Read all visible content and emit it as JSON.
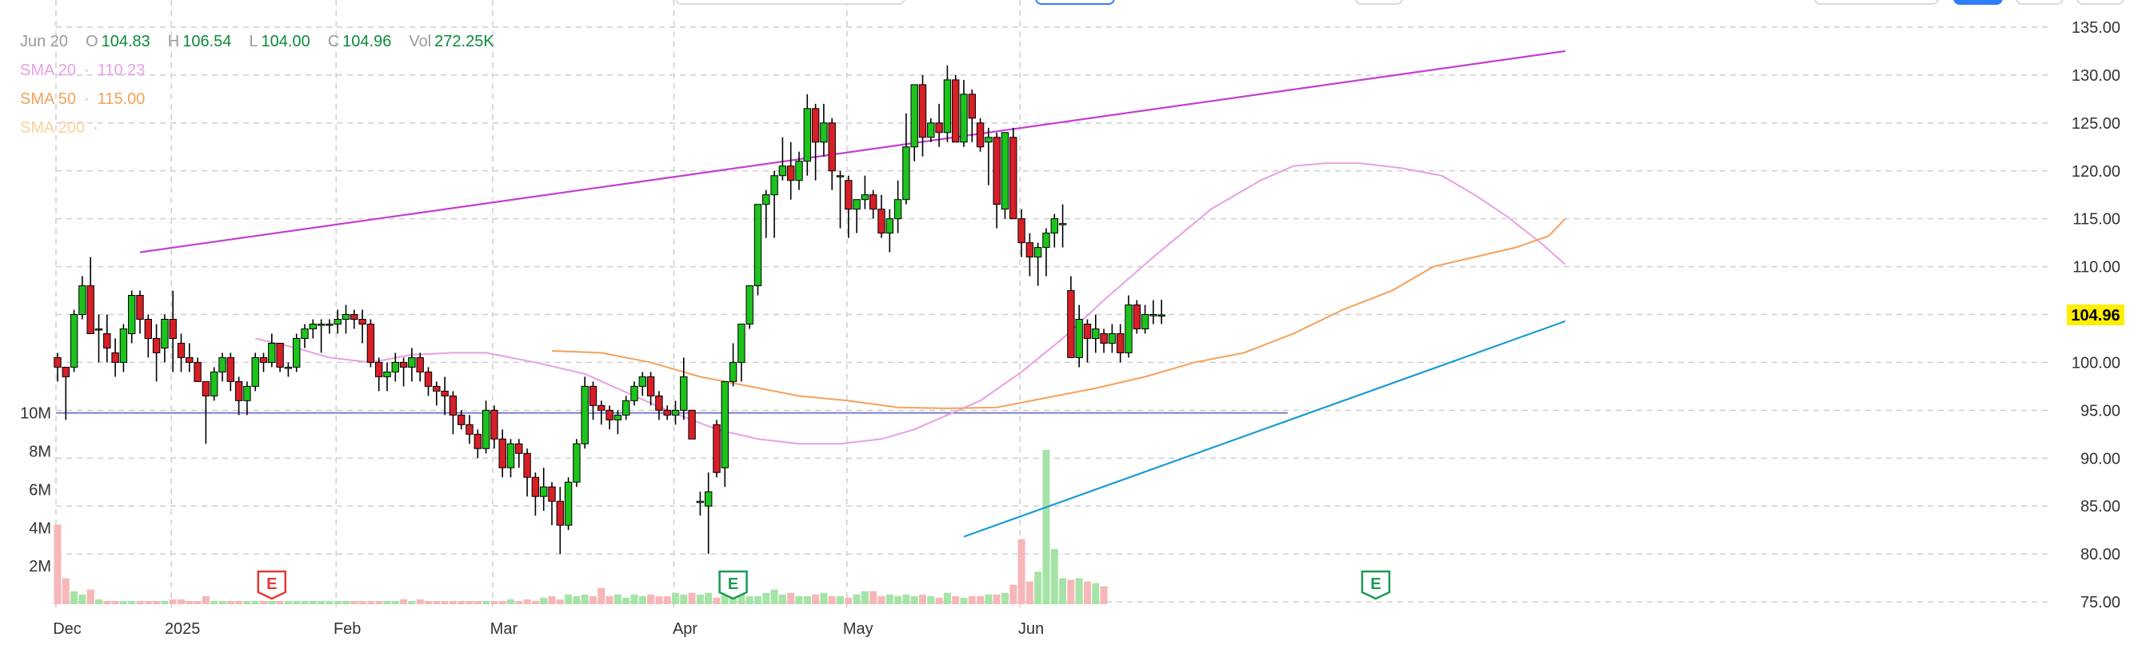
{
  "legend": {
    "date": "Jun 20",
    "open_label": "O",
    "open": "104.83",
    "high_label": "H",
    "high": "106.54",
    "low_label": "L",
    "low": "104.00",
    "close_label": "C",
    "close": "104.96",
    "vol_label": "Vol",
    "vol": "272.25K",
    "sma": [
      {
        "label": "SMA 20",
        "sep": "·",
        "value": "110.23",
        "color": "#e7a0e2"
      },
      {
        "label": "SMA 50",
        "sep": "·",
        "value": "115.00",
        "color": "#f5a15a"
      },
      {
        "label": "SMA 200",
        "sep": "·",
        "value": "",
        "color": "#f6d39a"
      }
    ]
  },
  "current_price": "104.96",
  "colors": {
    "up": "#1cc41c",
    "down": "#d61f26",
    "wick": "#000000",
    "grid": "#cfcfd4",
    "trendline_upper": "#c23fd1",
    "trendline_lower": "#1a9ad6",
    "sma20": "#e7a0e2",
    "sma50": "#f5a15a",
    "vol_up": "#a6e3a6",
    "vol_down": "#f6b7b9",
    "vol_ref": "#7c7ccf",
    "price_tag": "#ffee00",
    "earn_red": "#e53935",
    "earn_green": "#1a9a54"
  },
  "chart_data": {
    "type": "candlestick",
    "y_axis": {
      "ticks": [
        "135.00",
        "130.00",
        "125.00",
        "120.00",
        "115.00",
        "110.00",
        "105.00",
        "100.00",
        "95.00",
        "90.00",
        "85.00",
        "80.00",
        "75.00"
      ],
      "ylim": [
        75,
        135
      ]
    },
    "x_axis": {
      "labels": [
        "Dec",
        "2025",
        "Feb",
        "Mar",
        "Apr",
        "May",
        "Jun"
      ],
      "label_positions_index": [
        0,
        14,
        34,
        53,
        75,
        96,
        117
      ]
    },
    "volume_axis": {
      "labels": [
        "10M",
        "8M",
        "6M",
        "4M",
        "2M"
      ],
      "values": [
        10000000,
        8000000,
        6000000,
        4000000,
        2000000
      ],
      "reference_line": 10000000
    },
    "candles": [
      [
        100.5,
        101,
        98,
        99.5
      ],
      [
        99.5,
        99.5,
        94,
        98.5
      ],
      [
        99.5,
        105.5,
        99,
        105
      ],
      [
        105,
        109,
        104.5,
        108
      ],
      [
        108,
        111,
        104,
        103
      ],
      [
        103.5,
        105,
        100,
        103.5
      ],
      [
        103,
        105,
        100,
        101.5
      ],
      [
        101,
        102.5,
        98.5,
        100
      ],
      [
        100,
        104,
        99,
        103.5
      ],
      [
        103,
        107.5,
        102,
        107
      ],
      [
        107,
        107.5,
        103,
        104.5
      ],
      [
        104.5,
        105,
        100.5,
        102.5
      ],
      [
        102.5,
        104,
        98,
        101
      ],
      [
        101.5,
        105,
        100,
        104.5
      ],
      [
        104.5,
        107.5,
        99,
        102.5
      ],
      [
        102,
        103,
        99,
        100.5
      ],
      [
        100.5,
        102,
        99,
        100
      ],
      [
        100,
        100.5,
        98,
        98
      ],
      [
        98,
        98,
        91.5,
        96.5
      ],
      [
        96.5,
        99.5,
        96,
        99
      ],
      [
        99,
        101,
        98,
        100.5
      ],
      [
        100.5,
        101,
        97,
        98
      ],
      [
        98,
        98.5,
        94.5,
        96
      ],
      [
        96,
        98,
        94.5,
        97.5
      ],
      [
        97.5,
        101,
        97,
        100.5
      ],
      [
        100.5,
        101,
        99,
        100
      ],
      [
        100,
        103,
        99.5,
        102
      ],
      [
        102,
        102,
        99,
        99.5
      ],
      [
        99.5,
        100,
        98.5,
        99.5
      ],
      [
        99.5,
        103,
        99,
        102.5
      ],
      [
        102.5,
        104,
        101.5,
        103.5
      ],
      [
        103.5,
        104.5,
        102.5,
        104
      ],
      [
        104,
        104.5,
        101,
        104
      ],
      [
        104,
        104.5,
        103,
        104
      ],
      [
        104,
        105.5,
        103,
        104.5
      ],
      [
        104.5,
        106,
        103,
        105
      ],
      [
        105,
        105.5,
        103.5,
        104.5
      ],
      [
        104.5,
        105.5,
        102,
        104
      ],
      [
        104,
        104.5,
        99.5,
        100
      ],
      [
        100,
        100.5,
        97,
        98.5
      ],
      [
        98.5,
        100,
        97,
        99
      ],
      [
        99,
        101,
        98,
        100
      ],
      [
        100,
        100.5,
        97.5,
        99.5
      ],
      [
        99.5,
        101.5,
        98,
        100.5
      ],
      [
        100.5,
        101,
        98,
        99
      ],
      [
        99,
        99.5,
        96.5,
        97.5
      ],
      [
        97.5,
        98,
        95.5,
        97
      ],
      [
        97,
        98.5,
        94.5,
        96.5
      ],
      [
        96.5,
        97,
        92.5,
        94.5
      ],
      [
        94.5,
        95,
        93,
        93.5
      ],
      [
        93.5,
        94.5,
        91.5,
        92.5
      ],
      [
        92.5,
        93,
        90,
        91
      ],
      [
        91,
        96,
        90.5,
        95
      ],
      [
        95,
        95.5,
        91,
        92
      ],
      [
        92,
        93,
        88,
        89
      ],
      [
        89,
        92,
        88,
        91.5
      ],
      [
        91.5,
        92,
        89,
        90.5
      ],
      [
        90.5,
        91,
        86,
        88
      ],
      [
        88,
        88.5,
        84,
        86
      ],
      [
        86,
        89,
        84.5,
        87
      ],
      [
        87,
        87.5,
        83,
        85.5
      ],
      [
        85.5,
        87,
        80,
        83
      ],
      [
        83,
        88,
        82.5,
        87.5
      ],
      [
        87.5,
        92,
        87,
        91.5
      ],
      [
        91.5,
        98.5,
        91,
        97.5
      ],
      [
        97.5,
        98,
        94,
        95.5
      ],
      [
        95.5,
        96,
        93.5,
        95
      ],
      [
        95,
        95.5,
        93,
        94
      ],
      [
        94,
        95,
        92.5,
        94.5
      ],
      [
        94.5,
        96.5,
        94,
        96
      ],
      [
        96,
        98,
        95.5,
        97.5
      ],
      [
        97.5,
        99,
        96.5,
        98.5
      ],
      [
        98.5,
        99,
        95.5,
        96.5
      ],
      [
        96.5,
        97,
        94,
        95
      ],
      [
        95,
        95.5,
        94,
        94.5
      ],
      [
        94.5,
        96,
        93.5,
        95
      ],
      [
        95,
        100.5,
        94,
        98.5
      ],
      [
        95,
        95,
        92,
        92
      ],
      [
        85.5,
        86.5,
        84,
        85.5
      ],
      [
        85,
        88.5,
        80,
        86.5
      ],
      [
        93.5,
        94,
        88,
        88.5
      ],
      [
        89,
        98,
        87,
        98
      ],
      [
        98,
        102,
        97.5,
        100
      ],
      [
        100,
        104,
        98,
        104
      ],
      [
        104,
        108,
        103.5,
        108
      ],
      [
        108,
        116,
        107,
        116.5
      ],
      [
        116.5,
        118,
        113,
        117.5
      ],
      [
        117.5,
        120,
        113,
        119.5
      ],
      [
        119.5,
        123.5,
        119,
        120.5
      ],
      [
        120.5,
        123,
        117,
        119
      ],
      [
        119,
        122,
        118,
        121
      ],
      [
        121,
        128,
        119.5,
        126.5
      ],
      [
        126.5,
        127,
        119,
        123
      ],
      [
        123,
        127,
        121.5,
        125
      ],
      [
        125,
        125.5,
        118,
        120
      ],
      [
        119.5,
        120,
        114,
        119.5
      ],
      [
        119,
        119.5,
        113,
        116
      ],
      [
        116,
        117,
        113.5,
        117
      ],
      [
        117,
        119.5,
        116,
        117.5
      ],
      [
        117.5,
        118,
        115,
        116
      ],
      [
        116,
        117.5,
        113,
        113.5
      ],
      [
        113.5,
        116,
        111.5,
        115
      ],
      [
        115,
        119,
        113.5,
        117
      ],
      [
        117,
        126,
        116.5,
        122.5
      ],
      [
        122.5,
        128,
        121,
        129
      ],
      [
        129,
        130,
        121.5,
        123.5
      ],
      [
        123.5,
        125.5,
        123,
        125
      ],
      [
        125,
        127,
        122.5,
        124
      ],
      [
        124,
        131,
        123,
        129.5
      ],
      [
        129.5,
        130,
        123,
        123
      ],
      [
        123,
        129.5,
        122.5,
        128
      ],
      [
        128,
        128.5,
        123,
        125.5
      ],
      [
        125,
        125.5,
        122,
        122.5
      ],
      [
        123,
        124.5,
        118.5,
        123.5
      ],
      [
        123.5,
        124,
        114,
        116.5
      ],
      [
        116,
        123.5,
        115,
        124
      ],
      [
        123.5,
        124.5,
        118.5,
        115
      ],
      [
        115,
        116,
        111,
        112.5
      ],
      [
        112.5,
        113.5,
        109,
        111
      ],
      [
        111,
        112.5,
        108,
        112
      ],
      [
        112,
        114,
        109,
        113.5
      ],
      [
        113.5,
        115.5,
        112,
        115
      ],
      [
        114.5,
        116.5,
        112,
        114.5
      ],
      [
        107.5,
        109,
        103.5,
        100.5
      ],
      [
        100.5,
        106,
        99.5,
        104.5
      ],
      [
        104,
        104.5,
        100,
        102.5
      ],
      [
        102.5,
        105,
        101,
        103.5
      ],
      [
        103,
        103.5,
        101,
        102
      ],
      [
        102,
        104,
        101,
        103
      ],
      [
        103,
        104,
        100,
        101
      ],
      [
        101,
        107,
        100.5,
        106
      ],
      [
        106,
        106.5,
        103,
        103.5
      ],
      [
        103.5,
        106,
        103,
        105
      ],
      [
        105,
        106.5,
        104,
        105
      ],
      [
        104.83,
        106.54,
        104,
        104.96
      ]
    ],
    "volume_millions": [
      4.9,
      1.6,
      0.8,
      0.6,
      0.9,
      0.3,
      0.2,
      0.2,
      0.2,
      0.2,
      0.2,
      0.2,
      0.2,
      0.2,
      0.3,
      0.3,
      0.2,
      0.2,
      0.5,
      0.2,
      0.2,
      0.2,
      0.2,
      0.2,
      0.2,
      0.2,
      0.2,
      0.2,
      0.2,
      0.2,
      0.2,
      0.2,
      0.2,
      0.2,
      0.2,
      0.2,
      0.2,
      0.2,
      0.2,
      0.2,
      0.2,
      0.2,
      0.3,
      0.2,
      0.3,
      0.2,
      0.2,
      0.2,
      0.2,
      0.2,
      0.2,
      0.2,
      0.2,
      0.2,
      0.2,
      0.3,
      0.2,
      0.3,
      0.2,
      0.4,
      0.5,
      0.3,
      0.6,
      0.5,
      0.6,
      0.5,
      1.0,
      0.5,
      0.6,
      0.4,
      0.6,
      0.5,
      0.6,
      0.5,
      0.5,
      0.7,
      0.6,
      0.7,
      0.6,
      0.7,
      0.4,
      0.6,
      0.6,
      0.6,
      0.5,
      0.5,
      0.7,
      0.9,
      0.6,
      0.7,
      0.5,
      0.5,
      0.6,
      0.7,
      0.5,
      0.5,
      0.4,
      0.6,
      0.8,
      0.8,
      0.5,
      0.6,
      0.5,
      0.6,
      0.5,
      0.6,
      0.5,
      0.4,
      0.7,
      0.5,
      0.4,
      0.5,
      0.5,
      0.6,
      0.6,
      0.7,
      1.2,
      4.0,
      1.4,
      2.0,
      9.5,
      3.4,
      1.6,
      1.5,
      1.6,
      1.4,
      1.3,
      1.1
    ],
    "sma20": [
      [
        24,
        102.5
      ],
      [
        29,
        101.5
      ],
      [
        33,
        100.5
      ],
      [
        38,
        100
      ],
      [
        43,
        100.8
      ],
      [
        48,
        101
      ],
      [
        52,
        101
      ],
      [
        58,
        100
      ],
      [
        64,
        98.8
      ],
      [
        70,
        96.5
      ],
      [
        74,
        95
      ],
      [
        80,
        93
      ],
      [
        85,
        92
      ],
      [
        90,
        91.5
      ],
      [
        95,
        91.5
      ],
      [
        100,
        92
      ],
      [
        104,
        93
      ],
      [
        108,
        94.5
      ],
      [
        112,
        96
      ],
      [
        117,
        99
      ],
      [
        122,
        102.5
      ],
      [
        127,
        106.5
      ],
      [
        133,
        111
      ],
      [
        140,
        116
      ],
      [
        146,
        119
      ],
      [
        150,
        120.5
      ],
      [
        154,
        120.8
      ],
      [
        158,
        120.8
      ],
      [
        163,
        120.3
      ],
      [
        168,
        119.5
      ],
      [
        172,
        117.5
      ],
      [
        176,
        115.2
      ],
      [
        180,
        112.5
      ],
      [
        183,
        110.23
      ]
    ],
    "sma50": [
      [
        60,
        101.2
      ],
      [
        66,
        101
      ],
      [
        72,
        100
      ],
      [
        78,
        98.5
      ],
      [
        84,
        97.5
      ],
      [
        90,
        96.5
      ],
      [
        96,
        96
      ],
      [
        102,
        95.3
      ],
      [
        108,
        95.2
      ],
      [
        114,
        95.3
      ],
      [
        120,
        96.3
      ],
      [
        126,
        97.3
      ],
      [
        132,
        98.5
      ],
      [
        138,
        100
      ],
      [
        144,
        101
      ],
      [
        150,
        103
      ],
      [
        156,
        105.5
      ],
      [
        162,
        107.5
      ],
      [
        167,
        110
      ],
      [
        172,
        111
      ],
      [
        177,
        112
      ],
      [
        181,
        113.2
      ],
      [
        183,
        115.0
      ]
    ],
    "trend_upper": [
      [
        10,
        111.5
      ],
      [
        183,
        132.5
      ]
    ],
    "trend_lower": [
      [
        110,
        81.8
      ],
      [
        183,
        104.3
      ]
    ],
    "earnings_markers": [
      {
        "label": "E",
        "index": 26,
        "color": "red"
      },
      {
        "label": "E",
        "index": 82,
        "color": "green"
      },
      {
        "label": "E",
        "index": 160,
        "color": "green"
      }
    ]
  }
}
